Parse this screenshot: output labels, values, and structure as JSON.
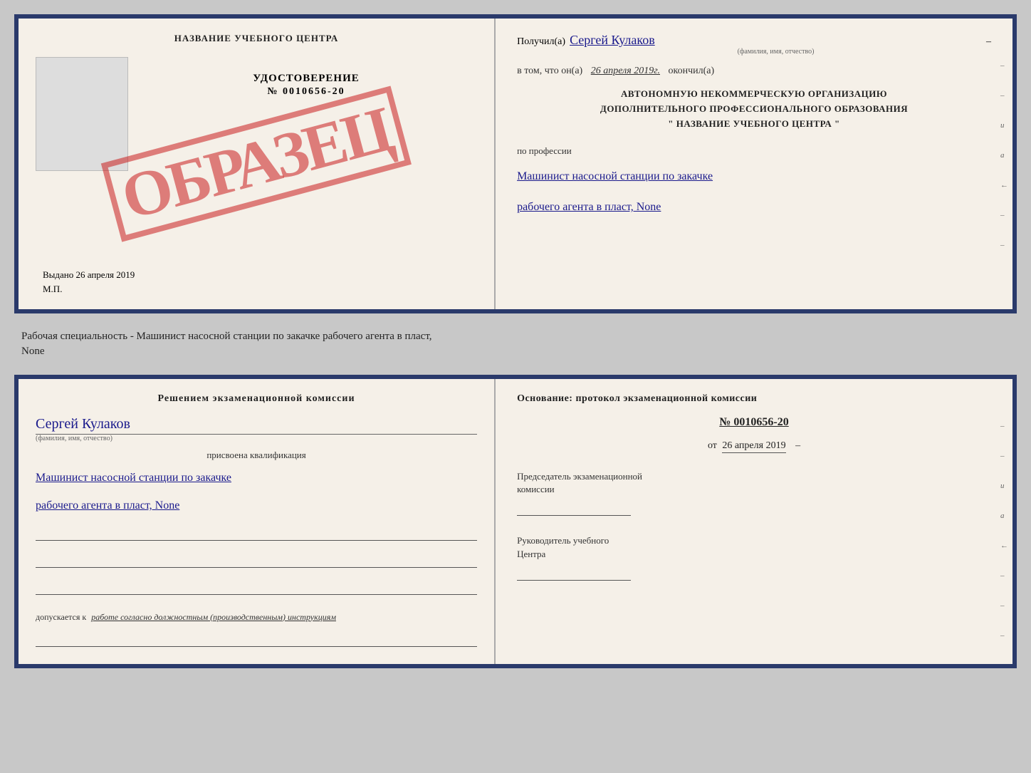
{
  "top_cert": {
    "left": {
      "center_title": "НАЗВАНИЕ УЧЕБНОГО ЦЕНТРА",
      "stamp_text": "ОБРАЗЕЦ",
      "udost_label": "УДОСТОВЕРЕНИЕ",
      "udost_number": "№ 0010656-20",
      "vydano_text": "Выдано 26 апреля 2019",
      "mp_text": "М.П."
    },
    "right": {
      "received_prefix": "Получил(а)",
      "received_name": "Сергей Кулаков",
      "name_hint": "(фамилия, имя, отчество)",
      "date_prefix": "в том, что он(а)",
      "date_value": "26 апреля 2019г.",
      "date_suffix": "окончил(а)",
      "org_line1": "АВТОНОМНУЮ НЕКОММЕРЧЕСКУЮ ОРГАНИЗАЦИЮ",
      "org_line2": "ДОПОЛНИТЕЛЬНОГО ПРОФЕССИОНАЛЬНОГО ОБРАЗОВАНИЯ",
      "org_line3": "\"  НАЗВАНИЕ УЧЕБНОГО ЦЕНТРА  \"",
      "profession_label": "по профессии",
      "profession_line1": "Машинист насосной станции по закачке",
      "profession_line2": "рабочего агента в пласт, None"
    }
  },
  "middle": {
    "text": "Рабочая специальность - Машинист насосной станции по закачке рабочего агента в пласт,",
    "text2": "None"
  },
  "bottom_cert": {
    "left": {
      "commission_title": "Решением экзаменационной комиссии",
      "person_name": "Сергей Кулаков",
      "name_hint": "(фамилия, имя, отчество)",
      "assigned_label": "присвоена квалификация",
      "qual_line1": "Машинист насосной станции по закачке",
      "qual_line2": "рабочего агента в пласт, None",
      "allowed_prefix": "допускается к",
      "allowed_text": "работе согласно должностным (производственным) инструкциям"
    },
    "right": {
      "osnov_label": "Основание: протокол экзаменационной комиссии",
      "protocol_number": "№ 0010656-20",
      "from_date_prefix": "от",
      "from_date": "26 апреля 2019",
      "chairman_label": "Председатель экзаменационной",
      "chairman_label2": "комиссии",
      "leader_label": "Руководитель учебного",
      "leader_label2": "Центра"
    }
  }
}
